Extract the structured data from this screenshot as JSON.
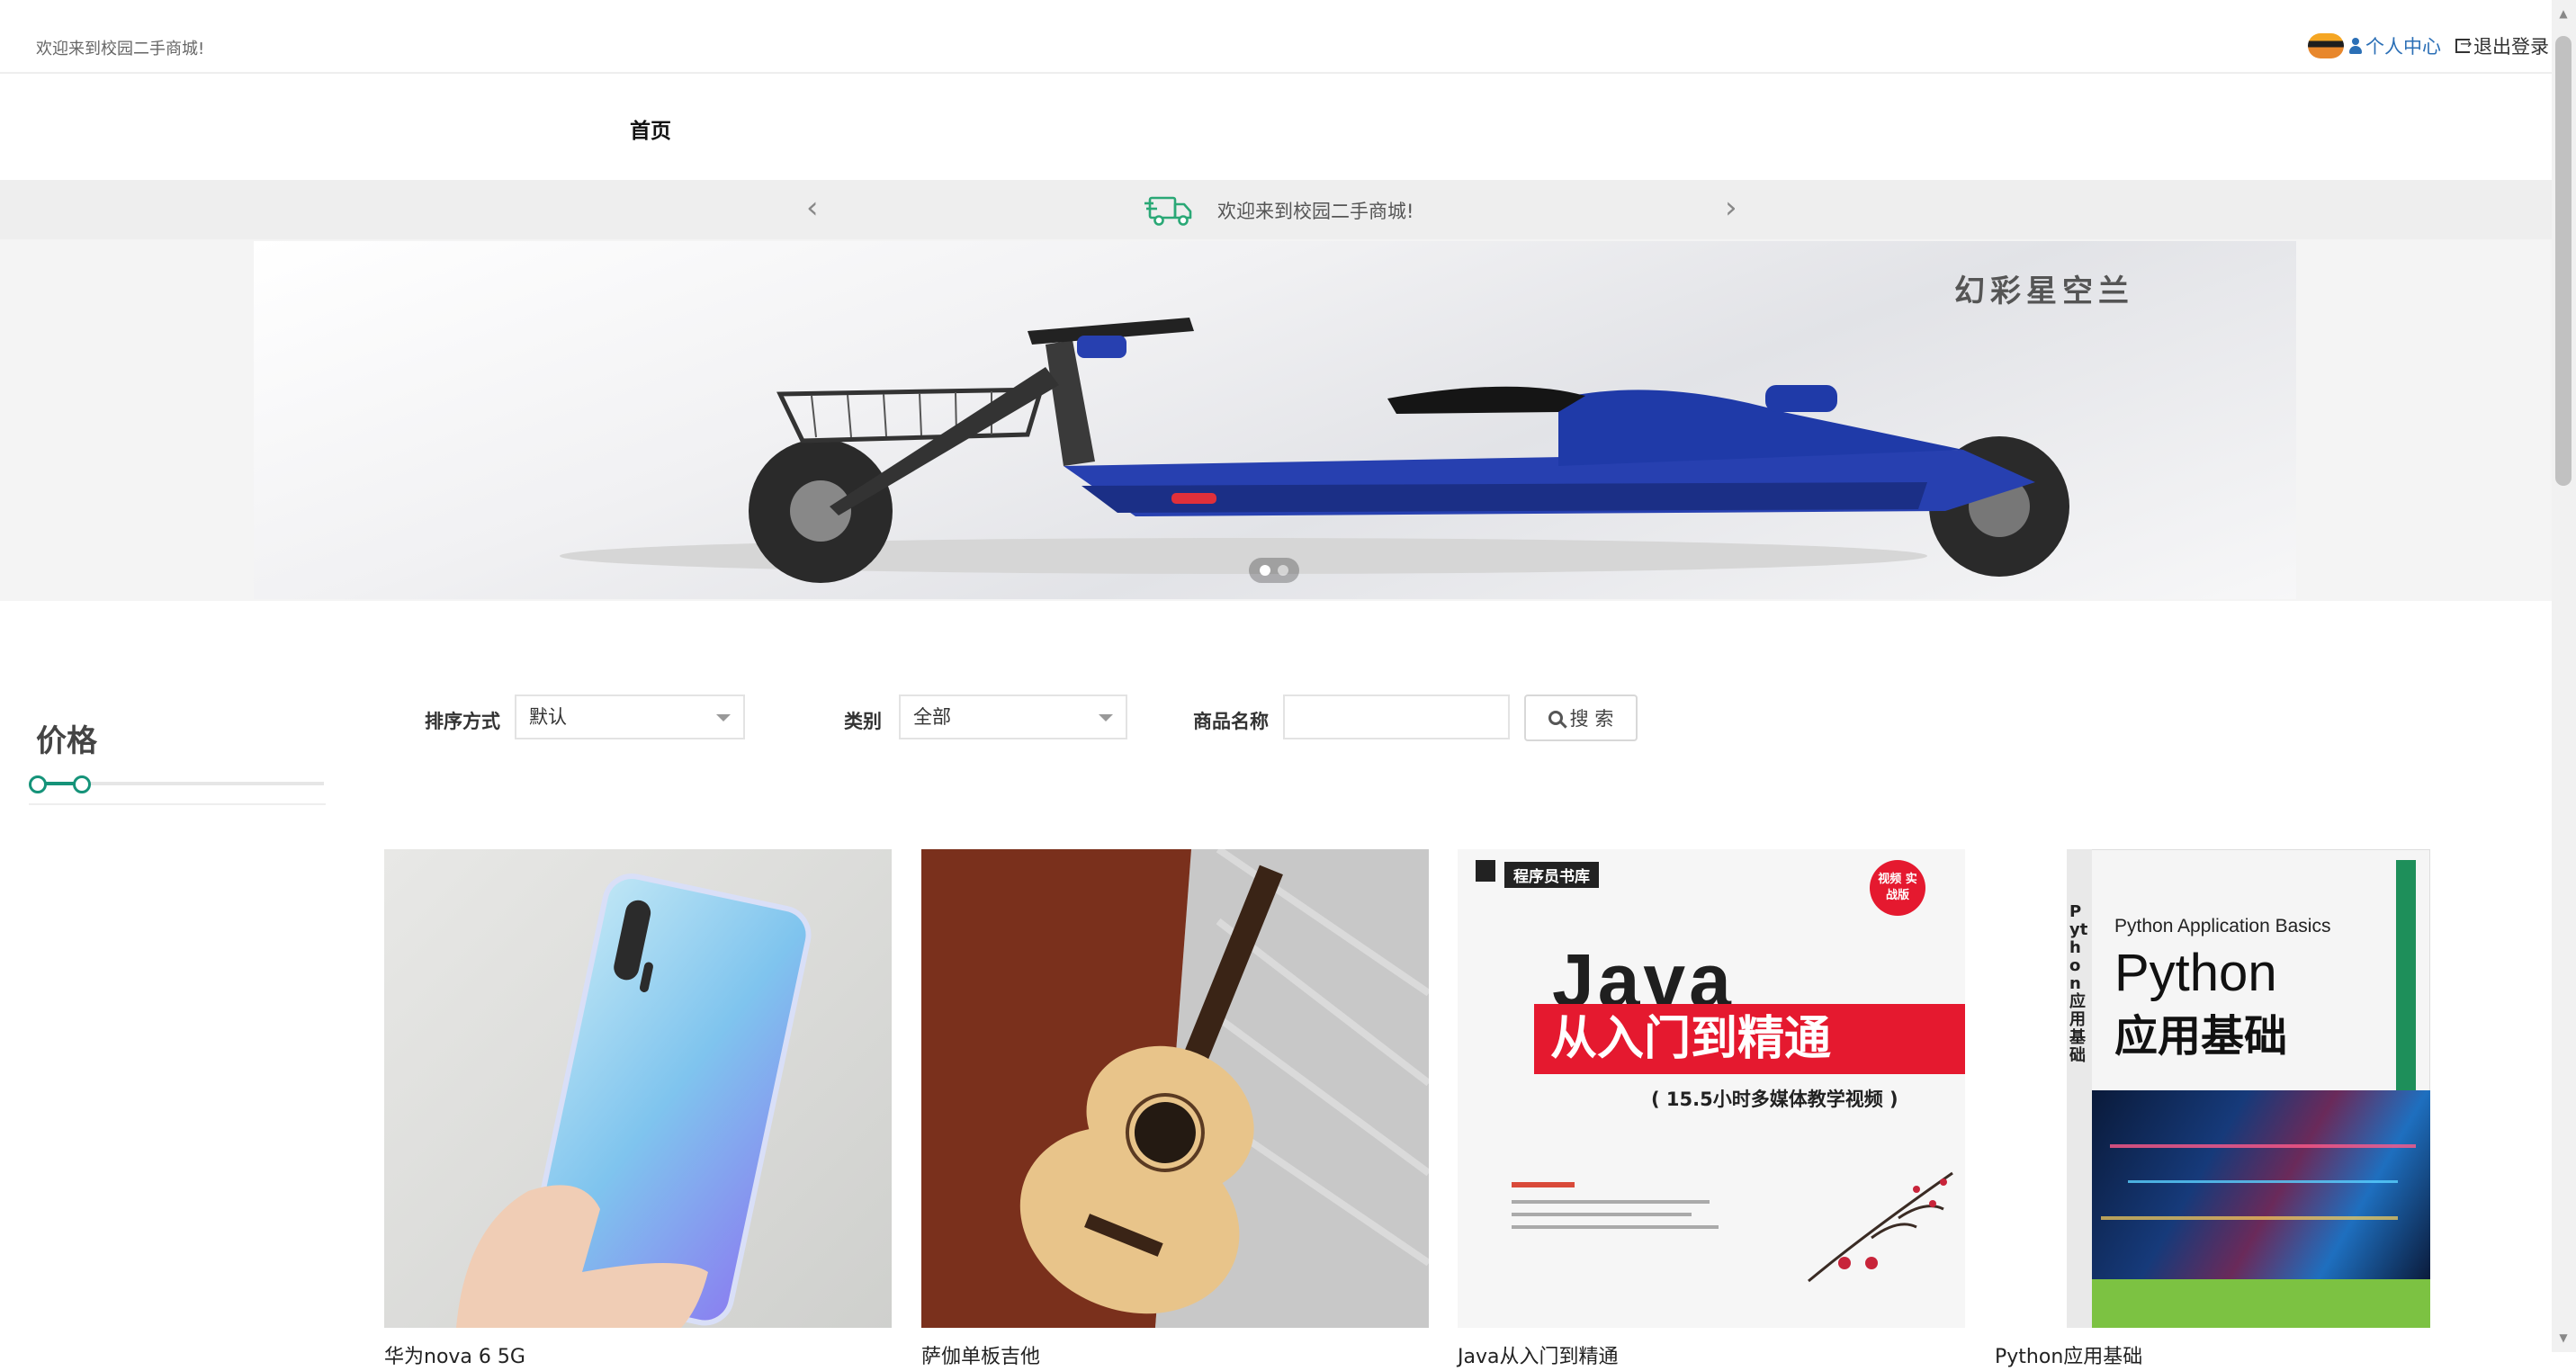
{
  "topbar": {
    "welcome": "欢迎来到校园二手商城!",
    "personal_center": "个人中心",
    "logout": "退出登录"
  },
  "nav": {
    "home": "首页"
  },
  "notice": {
    "text": "欢迎来到校园二手商城!"
  },
  "banner": {
    "caption": "幻彩星空兰",
    "slide_count": 2,
    "active_slide": 1
  },
  "sidebar": {
    "price_title": "价格"
  },
  "filters": {
    "sort_label": "排序方式",
    "sort_value": "默认",
    "category_label": "类别",
    "category_value": "全部",
    "name_label": "商品名称",
    "name_value": "",
    "search_button": "搜 索"
  },
  "products": [
    {
      "name": "华为nova 6 5G"
    },
    {
      "name": "萨伽单板吉他"
    },
    {
      "name": "Java从入门到精通"
    },
    {
      "name": "Python应用基础"
    }
  ],
  "java_book": {
    "series": "程序员书库",
    "title_en": "Java",
    "title_cn": "从入门到精通",
    "subtitle": "( 15.5小时多媒体教学视频 )",
    "badge": "视频 实战版"
  },
  "python_book": {
    "title_small": "Python Application Basics",
    "title_big": "Python",
    "title_cn": "应用基础",
    "spine": "Python应用基础"
  },
  "colors": {
    "accent": "#159379",
    "link": "#2b6fb6",
    "notice_bg": "#eeeeee",
    "java_red": "#e5192f"
  }
}
